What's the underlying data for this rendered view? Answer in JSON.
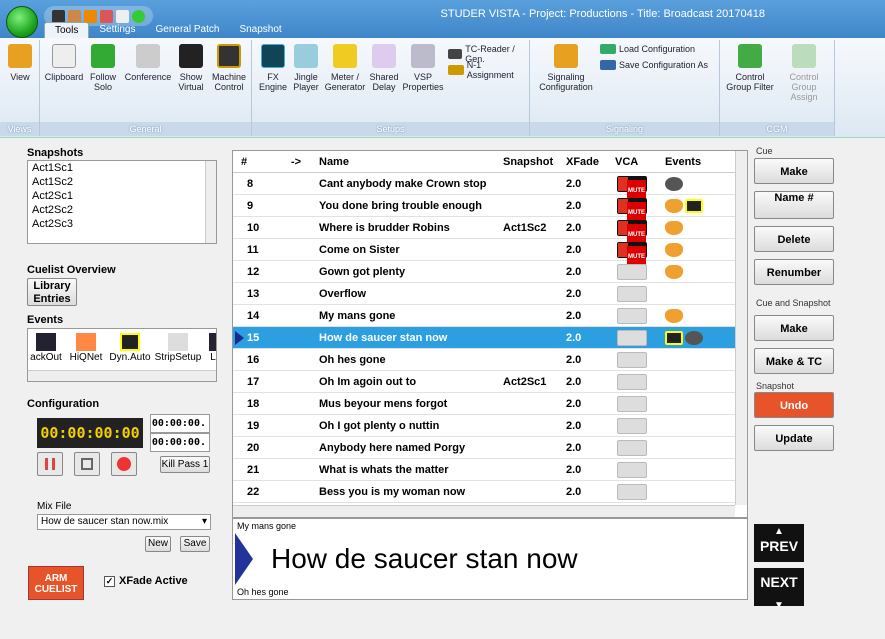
{
  "window_title": "STUDER VISTA - Project: Productions - Title: Broadcast 20170418",
  "tabs": [
    "Tools",
    "Settings",
    "General Patch",
    "Snapshot"
  ],
  "ribbon": {
    "views": {
      "label": "Views",
      "buttons": [
        "View"
      ]
    },
    "general": {
      "label": "General",
      "buttons": [
        "Clipboard",
        "Follow Solo",
        "Conference",
        "Show Virtual",
        "Machine Control"
      ]
    },
    "setups": {
      "label": "Setups",
      "buttons": [
        "FX Engine",
        "Jingle Player",
        "Meter / Generator",
        "Shared Delay",
        "VSP Properties"
      ],
      "small": [
        "TC-Reader / Gen.",
        "N-1 Assignment"
      ]
    },
    "signaling": {
      "label": "Signaling",
      "buttons": [
        "Signaling Configuration"
      ],
      "small": [
        "Load Configuration",
        "Save Configuration As"
      ]
    },
    "cgm": {
      "label": "CGM",
      "buttons": [
        "Control Group Filter",
        "Control Group Assign"
      ]
    }
  },
  "snapshots": {
    "label": "Snapshots",
    "items": [
      "Act1Sc1",
      "Act1Sc2",
      "Act2Sc1",
      "Act2Sc2",
      "Act2Sc3"
    ]
  },
  "cuelist_overview": {
    "label": "Cuelist Overview",
    "button": "Library Entries"
  },
  "events": {
    "label": "Events",
    "items": [
      "ackOut",
      "HiQNet",
      "Dyn.Auto",
      "StripSetup",
      "L"
    ]
  },
  "configuration": {
    "label": "Configuration",
    "timecode": "00:00:00:00",
    "tc1": "00:00:00.",
    "tc2": "00:00:00.",
    "kill": "Kill Pass 1",
    "mixfile_label": "Mix File",
    "mixfile": "How de saucer stan now.mix",
    "new": "New",
    "save": "Save"
  },
  "arm": "ARM CUELIST",
  "xfade_active": "XFade Active",
  "grid": {
    "headers": [
      "#",
      "->",
      "Name",
      "Snapshot",
      "XFade",
      "VCA",
      "Events"
    ],
    "rows": [
      {
        "n": "8",
        "name": "Cant anybody make Crown stop",
        "snap": "",
        "xf": "2.0",
        "vca": "on",
        "ev": [
          "g"
        ]
      },
      {
        "n": "9",
        "name": "You done bring trouble enough",
        "snap": "",
        "xf": "2.0",
        "vca": "on",
        "ev": [
          "mask",
          "a"
        ]
      },
      {
        "n": "10",
        "name": "Where is brudder Robins",
        "snap": "Act1Sc2",
        "xf": "2.0",
        "vca": "on",
        "ev": [
          "mask"
        ]
      },
      {
        "n": "11",
        "name": "Come on Sister",
        "snap": "",
        "xf": "2.0",
        "vca": "on",
        "ev": [
          "mask"
        ]
      },
      {
        "n": "12",
        "name": "Gown got plenty",
        "snap": "",
        "xf": "2.0",
        "vca": "off",
        "ev": [
          "mask"
        ]
      },
      {
        "n": "13",
        "name": "Overflow",
        "snap": "",
        "xf": "2.0",
        "vca": "off",
        "ev": []
      },
      {
        "n": "14",
        "name": "My mans gone",
        "snap": "",
        "xf": "2.0",
        "vca": "off",
        "ev": [
          "mask"
        ]
      },
      {
        "n": "15",
        "name": "How de saucer stan now",
        "snap": "",
        "xf": "2.0",
        "vca": "off",
        "ev": [
          "a",
          "g"
        ],
        "sel": true
      },
      {
        "n": "16",
        "name": "Oh hes gone",
        "snap": "",
        "xf": "2.0",
        "vca": "off",
        "ev": []
      },
      {
        "n": "17",
        "name": "Oh Im agoin out to",
        "snap": "Act2Sc1",
        "xf": "2.0",
        "vca": "off",
        "ev": []
      },
      {
        "n": "18",
        "name": "Mus beyour mens forgot",
        "snap": "",
        "xf": "2.0",
        "vca": "off",
        "ev": []
      },
      {
        "n": "19",
        "name": "Oh I got plenty o nuttin",
        "snap": "",
        "xf": "2.0",
        "vca": "off",
        "ev": []
      },
      {
        "n": "20",
        "name": "Anybody here named Porgy",
        "snap": "",
        "xf": "2.0",
        "vca": "off",
        "ev": []
      },
      {
        "n": "21",
        "name": "What is whats the matter",
        "snap": "",
        "xf": "2.0",
        "vca": "off",
        "ev": []
      },
      {
        "n": "22",
        "name": "Bess you is my woman now",
        "snap": "",
        "xf": "2.0",
        "vca": "off",
        "ev": []
      }
    ]
  },
  "cue_display": {
    "prev": "My mans gone",
    "current": "How de saucer stan now",
    "next": "Oh hes gone"
  },
  "right": {
    "cue_label": "Cue",
    "make": "Make",
    "name": "Name #",
    "delete": "Delete",
    "renumber": "Renumber",
    "cs_label": "Cue and Snapshot",
    "cs_make": "Make",
    "make_tc": "Make & TC",
    "snap_label": "Snapshot",
    "undo": "Undo",
    "update": "Update"
  },
  "nav": {
    "prev": "PREV",
    "next": "NEXT"
  },
  "colors": {
    "accent": "#2b9fe0",
    "arm": "#e8542a",
    "undo": "#e8542a"
  }
}
